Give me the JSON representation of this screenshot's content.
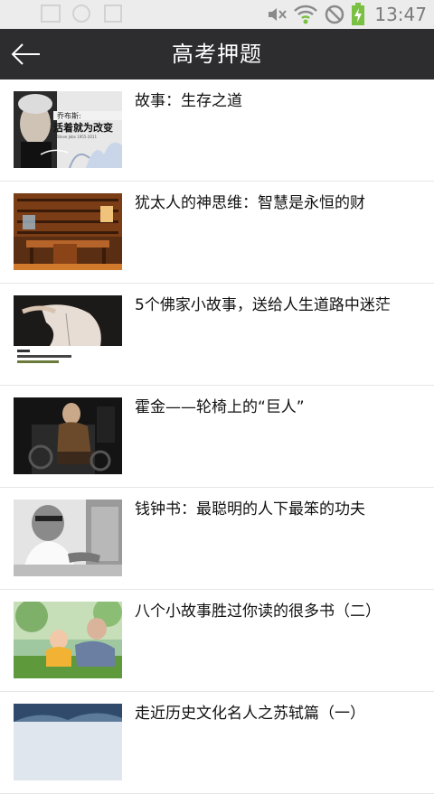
{
  "status_bar": {
    "time": "13:47",
    "icons": [
      "mute-icon",
      "wifi-icon",
      "no-sim-icon",
      "battery-charging-icon"
    ]
  },
  "header": {
    "title": "高考押题",
    "back_icon": "back-arrow-icon"
  },
  "articles": [
    {
      "title": "故事：生存之道",
      "thumbnail": {
        "label_top": "乔布斯:",
        "label_main": "活着就为改变",
        "label_small": "Steve Jobs 1955-2011"
      }
    },
    {
      "title": "犹太人的神思维：智慧是永恒的财"
    },
    {
      "title": "5个佛家小故事，送给人生道路中迷茫"
    },
    {
      "title": "霍金——轮椅上的“巨人”"
    },
    {
      "title": "钱钟书：最聪明的人下最笨的功夫"
    },
    {
      "title": "八个小故事胜过你读的很多书（二）"
    },
    {
      "title": "走近历史文化名人之苏轼篇（一）"
    }
  ],
  "colors": {
    "title_bar": "#2d2d30",
    "status_bar": "#ececec",
    "battery": "#7ac143"
  }
}
